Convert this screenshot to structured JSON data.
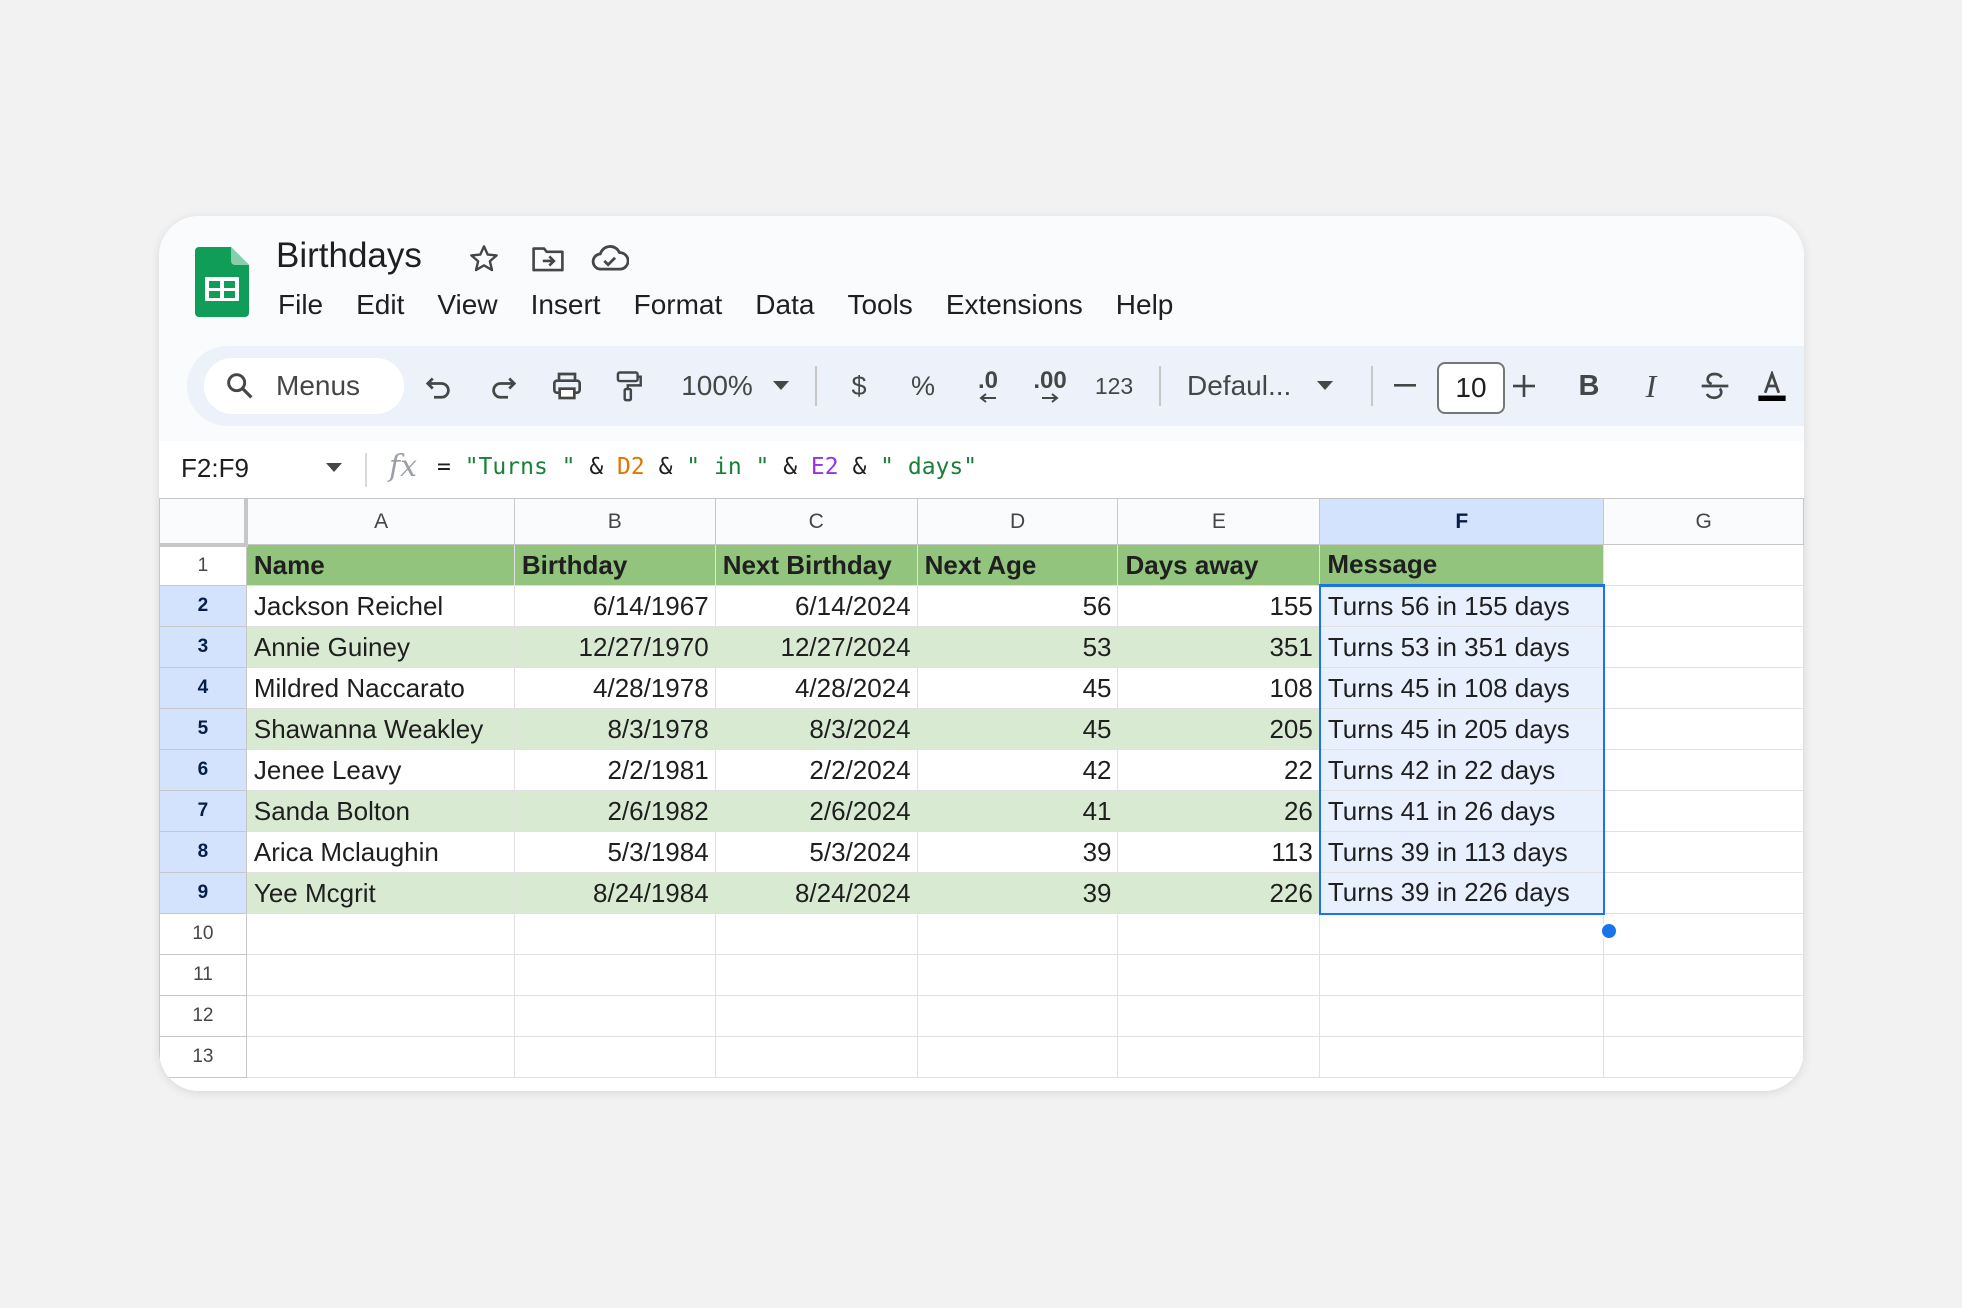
{
  "app": {
    "doc_title": "Birthdays",
    "menu": [
      "File",
      "Edit",
      "View",
      "Insert",
      "Format",
      "Data",
      "Tools",
      "Extensions",
      "Help"
    ]
  },
  "toolbar": {
    "search_label": "Menus",
    "zoom": "100%",
    "currency": "$",
    "percent": "%",
    "decrease_decimals": ".0",
    "increase_decimals": ".00",
    "number_format": "123",
    "font_name": "Defaul...",
    "font_size": "10",
    "bold": "B",
    "italic": "I"
  },
  "formula_bar": {
    "name_box": "F2:F9",
    "formula_parts": [
      "= ",
      "\"Turns \"",
      " & ",
      "D2",
      " & ",
      "\" in \"",
      " & ",
      "E2",
      " & ",
      "\" days\""
    ]
  },
  "sheet": {
    "columns": [
      "A",
      "B",
      "C",
      "D",
      "E",
      "F",
      "G"
    ],
    "selected_column": "F",
    "header_row": [
      "Name",
      "Birthday",
      "Next Birthday",
      "Next Age",
      "Days away",
      "Message"
    ],
    "rows": [
      [
        "Jackson Reichel",
        "6/14/1967",
        "6/14/2024",
        "56",
        "155",
        "Turns 56 in 155 days"
      ],
      [
        "Annie Guiney",
        "12/27/1970",
        "12/27/2024",
        "53",
        "351",
        "Turns 53 in 351 days"
      ],
      [
        "Mildred Naccarato",
        "4/28/1978",
        "4/28/2024",
        "45",
        "108",
        "Turns 45 in 108 days"
      ],
      [
        "Shawanna Weakley",
        "8/3/1978",
        "8/3/2024",
        "45",
        "205",
        "Turns 45 in 205 days"
      ],
      [
        "Jenee Leavy",
        "2/2/1981",
        "2/2/2024",
        "42",
        "22",
        "Turns 42 in 22 days"
      ],
      [
        "Sanda Bolton",
        "2/6/1982",
        "2/6/2024",
        "41",
        "26",
        "Turns 41 in 26 days"
      ],
      [
        "Arica Mclaughin",
        "5/3/1984",
        "5/3/2024",
        "39",
        "113",
        "Turns 39 in 113 days"
      ],
      [
        "Yee Mcgrit",
        "8/24/1984",
        "8/24/2024",
        "39",
        "226",
        "Turns 39 in 226 days"
      ]
    ],
    "row_numbers": [
      "1",
      "2",
      "3",
      "4",
      "5",
      "6",
      "7",
      "8",
      "9",
      "10",
      "11",
      "12",
      "13"
    ]
  },
  "colors": {
    "header_fill": "#93c47d",
    "band_fill": "#d9ead3",
    "selection": "#1a73e8",
    "sheets_green": "#0f9d58"
  }
}
